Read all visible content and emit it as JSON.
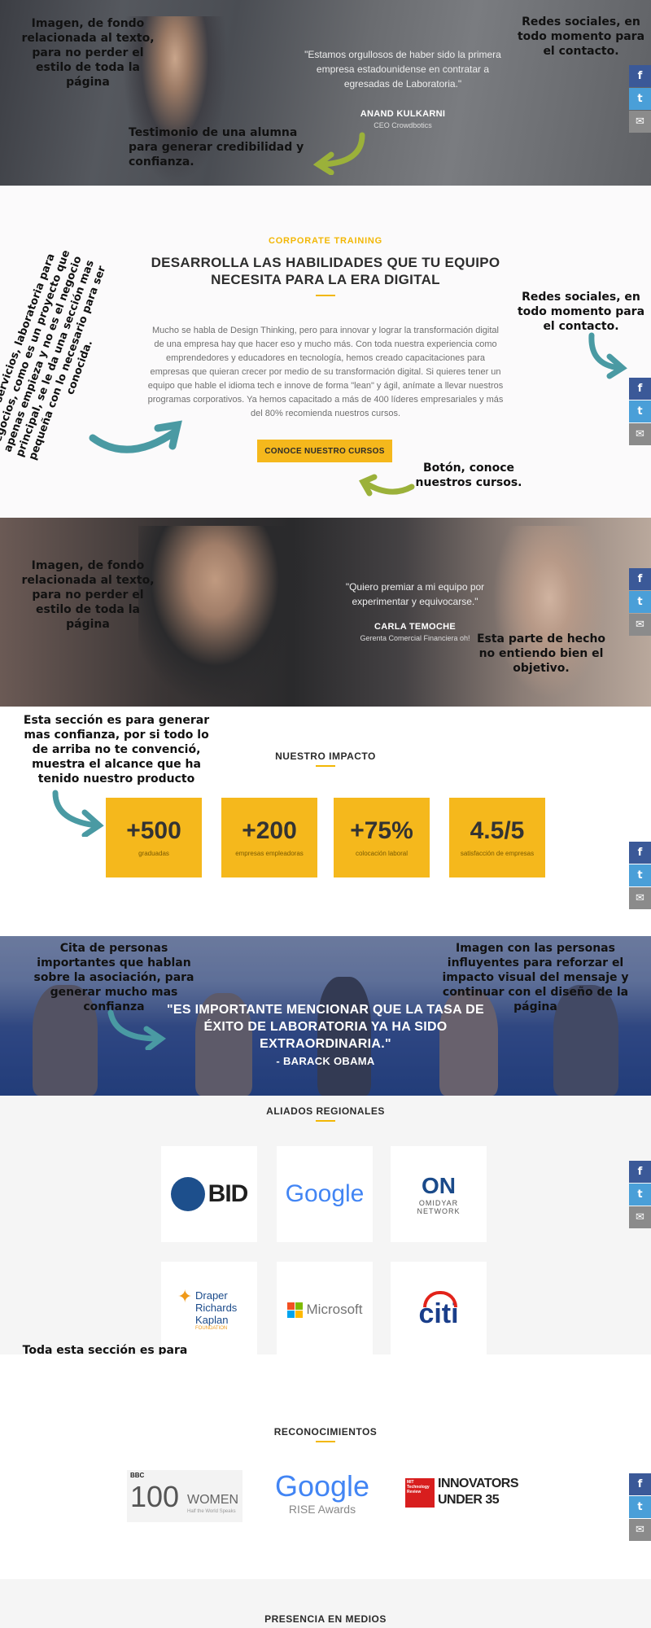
{
  "testimonial1": {
    "quote": "\"Estamos orgullosos de haber sido la primera empresa estadounidense en contratar a egresadas de Laboratoria.\"",
    "name": "ANAND KULKARNI",
    "role": "CEO Crowdbotics"
  },
  "corporate": {
    "eyebrow": "CORPORATE TRAINING",
    "title_line1": "DESARROLLA LAS HABILIDADES QUE TU EQUIPO",
    "title_line2": "NECESITA PARA LA ERA DIGITAL",
    "paragraph": "Mucho se habla de Design Thinking, pero para innovar y lograr la transformación digital de una empresa hay que hacer eso y mucho más. Con toda nuestra experiencia como emprendedores y educadores en tecnología, hemos creado capacitaciones para empresas que quieran crecer por medio de su transformación digital. Si quieres tener un equipo que hable el idioma tech e innove de forma \"lean\" y ágil, anímate a llevar nuestros programas corporativos. Ya hemos capacitado a más de 400 líderes empresariales y más del 80% recomienda nuestros cursos.",
    "cta_label": "CONOCE NUESTRO CURSOS"
  },
  "testimonial2": {
    "quote": "\"Quiero premiar a mi equipo por experimentar y equivocarse.\"",
    "name": "CARLA TEMOCHE",
    "role": "Gerenta Comercial Financiera oh!"
  },
  "impact": {
    "title": "NUESTRO IMPACTO",
    "stats": [
      {
        "value": "+500",
        "label": "graduadas"
      },
      {
        "value": "+200",
        "label": "empresas empleadoras"
      },
      {
        "value": "+75%",
        "label": "colocación laboral"
      },
      {
        "value": "4.5/5",
        "label": "satisfacción de empresas"
      }
    ]
  },
  "obama": {
    "quote": "\"ES IMPORTANTE MENCIONAR QUE LA TASA DE ÉXITO DE LABORATORIA YA HA SIDO EXTRAORDINARIA.\"",
    "author": "- BARACK OBAMA"
  },
  "allies": {
    "title": "ALIADOS REGIONALES",
    "logos": [
      "BID",
      "Google",
      "ON",
      "OMIDYAR",
      "NETWORK",
      "Draper",
      "Richards",
      "Kaplan",
      "FOUNDATION",
      "Microsoft",
      "citi"
    ]
  },
  "recognitions": {
    "title": "RECONOCIMIENTOS",
    "bbc": "BBC",
    "women_num": "100",
    "women_word": "WOMEN",
    "women_sub": "Half the World Speaks",
    "google": "Google",
    "rise": "RISE Awards",
    "mit": "MIT Technology Review",
    "innovators_l1": "INNOVATORS",
    "innovators_l2": "UNDER 35"
  },
  "media": {
    "title": "PRESENCIA EN MEDIOS"
  },
  "share": {
    "facebook": "f",
    "twitter": "t",
    "mail": "✉"
  },
  "annotations": {
    "img1": "Imagen, de fondo relacionada al texto, para no perder el estilo de toda la página",
    "social": "Redes sociales, en todo momento para el contacto.",
    "testimonial": "Testimonio de una alumna para generar credibilidad y confianza.",
    "services": "Otros servicios, laboratoria para negocios, como es un proyecto que apenas empieza y no es el negocio principal, se le da una sección mas pequeña con lo necesario para ser conocida.",
    "cta": "Botón, conoce nuestros cursos.",
    "unclear": "Esta parte de hecho no entiendo bien el objetivo.",
    "trust": "Esta sección es para generar mas confianza, por si todo lo de arriba no te convenció, muestra el alcance que ha tenido nuestro producto",
    "cite": "Cita de personas importantes que hablan sobre la asociación, para generar mucho mas confianza",
    "influencers": "Imagen con las personas influyentes para reforzar el impacto visual del mensaje y continuar con el diseño de la página",
    "relations": "Toda esta sección es para generar aún mas confianza, por si todo lo de arriba no te convenció, muestra todas las relaciones y alcance que tiene el producto"
  }
}
